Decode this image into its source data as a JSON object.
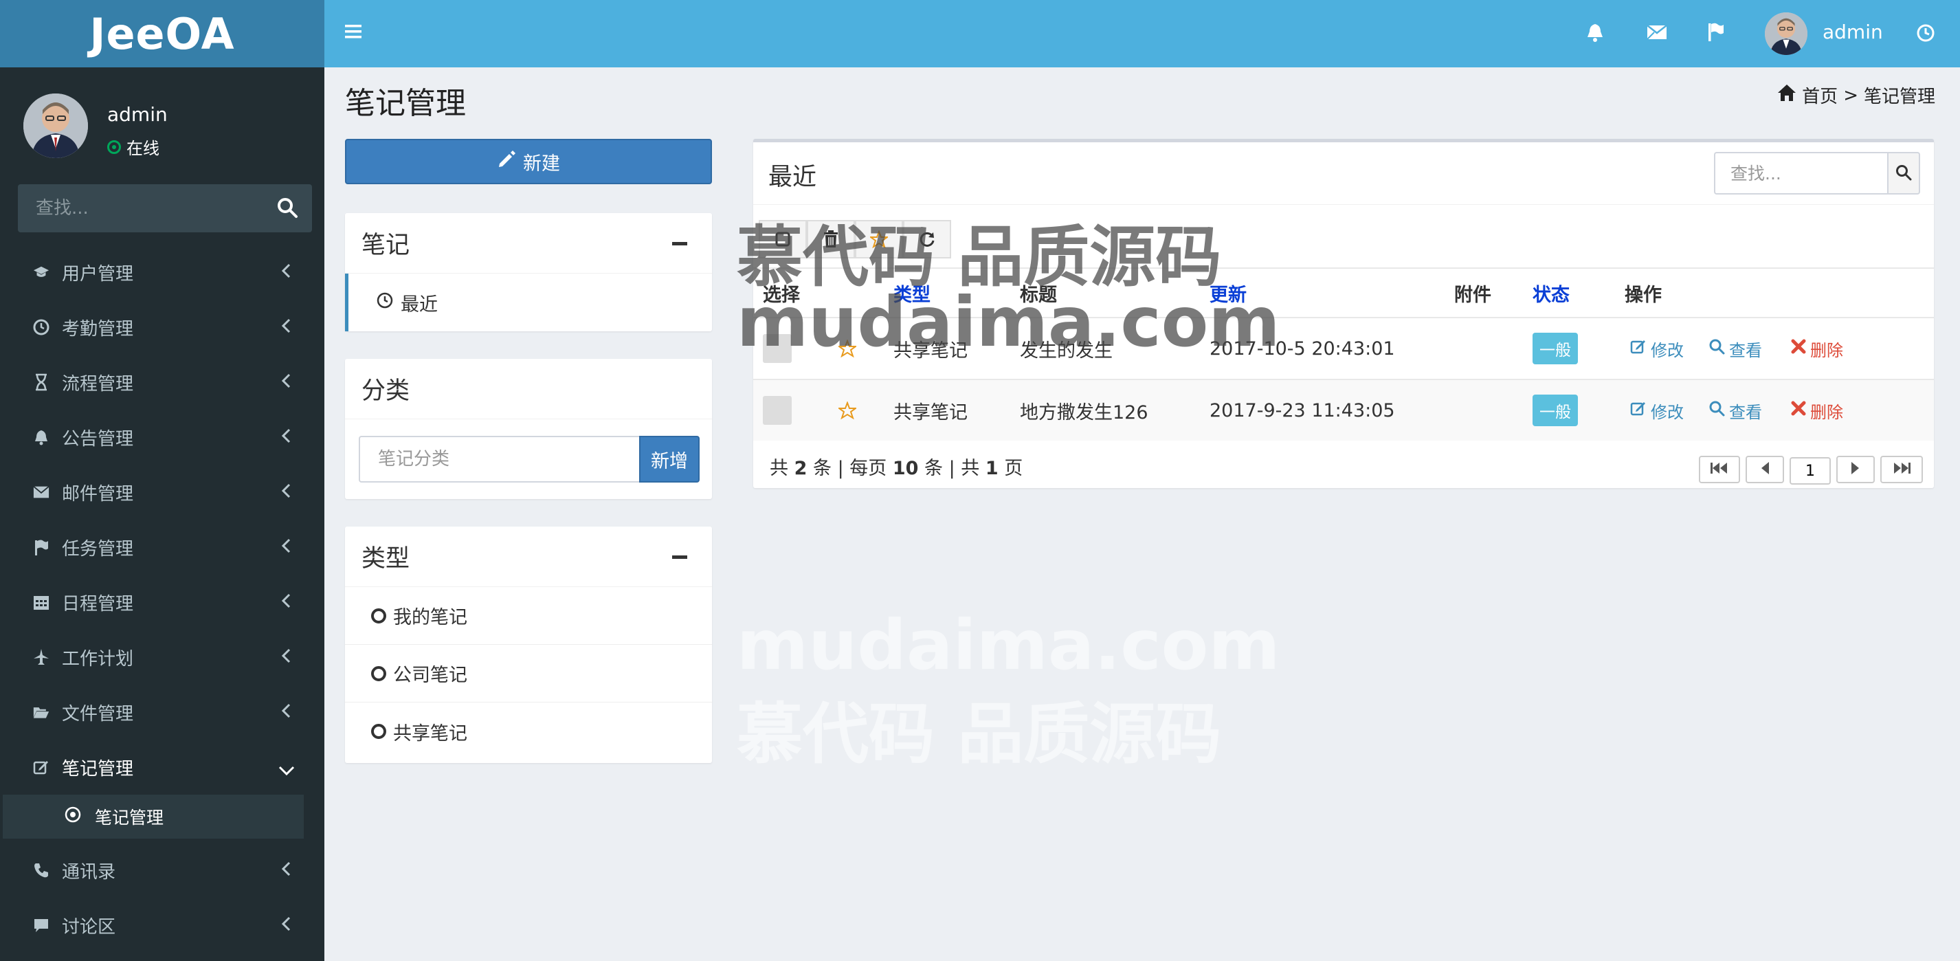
{
  "brand": {
    "logo_text": "JeeOA"
  },
  "sidebar": {
    "username": "admin",
    "status": "在线",
    "search_placeholder": "查找...",
    "menu": [
      {
        "label": "用户管理",
        "icon": "graduation-cap-icon"
      },
      {
        "label": "考勤管理",
        "icon": "clock-icon"
      },
      {
        "label": "流程管理",
        "icon": "hourglass-icon"
      },
      {
        "label": "公告管理",
        "icon": "bell-icon"
      },
      {
        "label": "邮件管理",
        "icon": "envelope-icon"
      },
      {
        "label": "任务管理",
        "icon": "flag-icon"
      },
      {
        "label": "日程管理",
        "icon": "calendar-icon"
      },
      {
        "label": "工作计划",
        "icon": "plane-icon"
      },
      {
        "label": "文件管理",
        "icon": "folder-open-icon"
      },
      {
        "label": "笔记管理",
        "icon": "edit-icon",
        "expanded": true
      },
      {
        "label": "通讯录",
        "icon": "phone-icon"
      },
      {
        "label": "讨论区",
        "icon": "comment-icon"
      }
    ],
    "submenu": {
      "label": "笔记管理",
      "icon": "dot-circle-icon"
    }
  },
  "topbar": {
    "username": "admin"
  },
  "page": {
    "title": "笔记管理",
    "breadcrumb": {
      "home": "首页",
      "separator": ">",
      "current": "笔记管理"
    }
  },
  "left": {
    "new_button": "新建",
    "notes_box": {
      "title": "笔记",
      "items": [
        {
          "label": "最近"
        }
      ]
    },
    "category_box": {
      "title": "分类",
      "input_placeholder": "笔记分类",
      "add_button": "新增"
    },
    "type_box": {
      "title": "类型",
      "items": [
        {
          "label": "我的笔记"
        },
        {
          "label": "公司笔记"
        },
        {
          "label": "共享笔记"
        }
      ]
    }
  },
  "main": {
    "title": "最近",
    "search_placeholder": "查找...",
    "columns": {
      "select": "选择",
      "type": "类型",
      "title": "标题",
      "updated": "更新",
      "attachment": "附件",
      "status": "状态",
      "actions": "操作"
    },
    "rows": [
      {
        "type": "共享笔记",
        "title": "发生的发生",
        "updated": "2017-10-5 20:43:01",
        "attachment": "",
        "status": "一般"
      },
      {
        "type": "共享笔记",
        "title": "地方撒发生126",
        "updated": "2017-9-23 11:43:05",
        "attachment": "",
        "status": "一般"
      }
    ],
    "actions": {
      "edit": "修改",
      "view": "查看",
      "delete": "删除"
    },
    "pager": {
      "p1": "共",
      "total": "2",
      "p2": "条 | 每页",
      "per_page": "10",
      "p3": "条 | 共",
      "pages": "1",
      "p4": "页",
      "current_page": "1"
    }
  },
  "watermark": {
    "line_cn": "慕代码 品质源码",
    "line_en": "mudaima.com"
  },
  "colors": {
    "sidebar_bg": "#222d32",
    "header_bg": "#4db0de",
    "logo_bg": "#367fa9",
    "primary": "#3d7fbf",
    "link": "#0a3fd6",
    "badge": "#5bc0de",
    "danger": "#dd4b39",
    "online": "#00a65a"
  }
}
